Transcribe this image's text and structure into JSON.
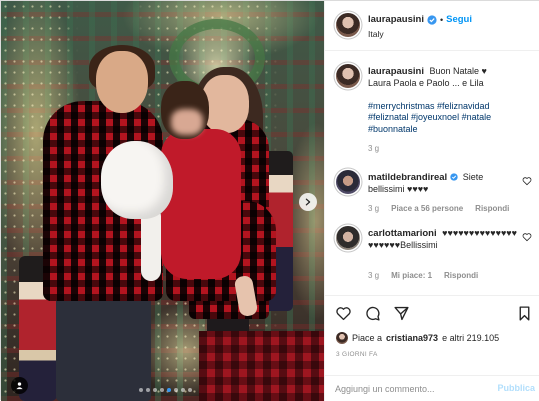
{
  "post": {
    "username": "laurapausini",
    "follow_label": "Segui",
    "separator": "•",
    "location": "Italy",
    "icons": {
      "verified": "verified-badge-icon",
      "next": "chevron-right-icon",
      "tag": "user-tag-icon"
    },
    "carousel": {
      "count": 8,
      "active_index": 4
    }
  },
  "caption": {
    "username": "laurapausini",
    "line1": "Buon Natale ♥",
    "line2": "Laura Paola e Paolo ... e Lila",
    "hashtags": "#merrychristmas #feliznavidad #feliznatal #joyeuxnoel #natale #buonnatale",
    "time": "3 g"
  },
  "comments": [
    {
      "username": "matildebrandireal",
      "text": "Siete bellissimi ♥♥♥♥",
      "time": "3 g",
      "likes": "Piace a 56 persone",
      "reply": "Rispondi"
    },
    {
      "username": "carlottamarioni",
      "text": "♥♥♥♥♥♥♥♥♥♥♥♥♥♥♥♥♥♥♥♥Bellissimi",
      "time": "3 g",
      "likes": "Mi piace: 1",
      "reply": "Rispondi"
    }
  ],
  "actions": {
    "like_icon": "heart-icon",
    "comment_icon": "comment-icon",
    "share_icon": "share-icon",
    "save_icon": "bookmark-icon",
    "likes_prefix": "Piace a",
    "likes_user": "cristiana973",
    "likes_suffix": "e altri 219.105",
    "posted_ago": "3 GIORNI FA"
  },
  "add_comment": {
    "placeholder": "Aggiungi un commento...",
    "publish": "Pubblica"
  },
  "colors": {
    "link": "#0095f6",
    "hashtag": "#00376b",
    "muted": "#8e8e8e",
    "publish_disabled": "#b2dffc"
  }
}
